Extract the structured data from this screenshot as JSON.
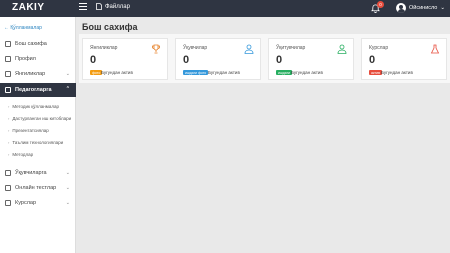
{
  "header": {
    "brand": "ZAKIY",
    "files_label": "Файллар",
    "notification_count": "0",
    "user_name": "Ойсинисло"
  },
  "sidebar": {
    "back_label": "← Қўлланмалар",
    "items": [
      {
        "label": "Бош сахифа"
      },
      {
        "label": "Профил"
      },
      {
        "label": "Янгиликлар"
      },
      {
        "label": "Педагогларга"
      },
      {
        "label": "Ўқувчиларга"
      },
      {
        "label": "Онлайн тестлар"
      },
      {
        "label": "Курслар"
      }
    ],
    "subitems": [
      {
        "label": "Методик қўлланмалар"
      },
      {
        "label": "Дастурланган иш китоблари"
      },
      {
        "label": "Презентатсиялар"
      },
      {
        "label": "Таълим технологиялари"
      },
      {
        "label": "Методлар"
      }
    ]
  },
  "main": {
    "title": "Бош сахифа",
    "cards": [
      {
        "label": "Янгиликлар",
        "value": "0",
        "badge": "фото",
        "badge_color": "#f39c12",
        "sub": "Бугундан актив",
        "icon_color": "#e67e22"
      },
      {
        "label": "Ўқувчилар",
        "value": "0",
        "badge": "ишдаги фото",
        "badge_color": "#3498db",
        "sub": "Бугундан актив",
        "icon_color": "#3498db"
      },
      {
        "label": "Ўқитувчилар",
        "value": "0",
        "badge": "ишдаги",
        "badge_color": "#27ae60",
        "sub": "Бугундан актив",
        "icon_color": "#27ae60"
      },
      {
        "label": "Курслар",
        "value": "0",
        "badge": "актив",
        "badge_color": "#e74c3c",
        "sub": "Бугундан актив",
        "icon_color": "#e74c3c"
      }
    ]
  }
}
